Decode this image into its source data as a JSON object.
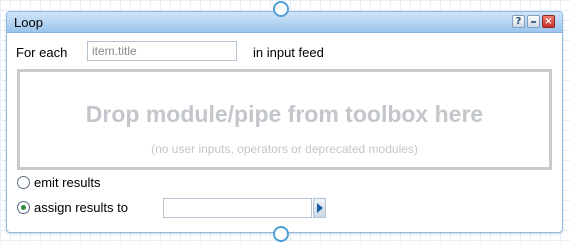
{
  "module": {
    "title": "Loop",
    "buttons": {
      "help_label": "?",
      "minimize_icon": "minimize-icon",
      "close_label": "×"
    }
  },
  "loop": {
    "for_each_label": "For each",
    "item_value": "item.title",
    "in_feed_label": "in input feed"
  },
  "dropzone": {
    "main_text": "Drop module/pipe from toolbox here",
    "sub_text": "(no user inputs, operators or deprecated modules)"
  },
  "options": {
    "emit_label": "emit results",
    "emit_selected": false,
    "assign_label": "assign results to",
    "assign_selected": true,
    "assign_value": ""
  },
  "colors": {
    "title_bar": "#9cc5ec",
    "connector": "#4f9fd7",
    "close_button": "#c9302a",
    "dropzone_text": "#c3c6ca"
  }
}
